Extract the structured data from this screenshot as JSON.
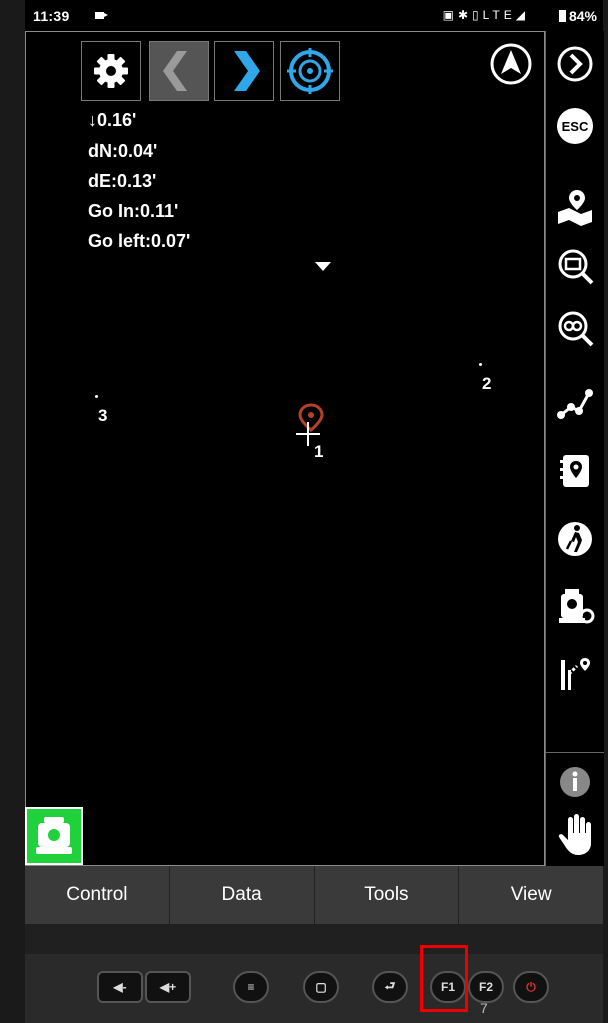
{
  "status_bar": {
    "time": "11:39",
    "network": "LTE",
    "battery": "84%"
  },
  "toolbar": {
    "settings_icon": "gear-icon",
    "back_icon": "chevron-left-icon",
    "forward_icon": "chevron-right-icon",
    "target_icon": "crosshair-target-icon"
  },
  "readouts": {
    "vertical": "↓0.16'",
    "dn": "dN:0.04'",
    "de": "dE:0.13'",
    "go_in": "Go In:0.11'",
    "go_left": "Go left:0.07'"
  },
  "points": [
    {
      "label": "1"
    },
    {
      "label": "2"
    },
    {
      "label": "3"
    }
  ],
  "sidebar": {
    "items": [
      {
        "icon": "chevron-right-circle-icon"
      },
      {
        "icon": "esc-icon",
        "label": "ESC"
      },
      {
        "icon": "map-pin-layers-icon"
      },
      {
        "icon": "zoom-extents-icon"
      },
      {
        "icon": "zoom-infinity-icon"
      },
      {
        "icon": "polyline-icon"
      },
      {
        "icon": "point-book-icon"
      },
      {
        "icon": "walking-person-icon"
      },
      {
        "icon": "total-station-icon"
      },
      {
        "icon": "stakeout-icon"
      },
      {
        "icon": "info-icon"
      },
      {
        "icon": "hand-pan-icon"
      }
    ]
  },
  "tabs": [
    {
      "label": "Control"
    },
    {
      "label": "Data"
    },
    {
      "label": "Tools"
    },
    {
      "label": "View"
    }
  ],
  "hardware_keys": {
    "f1": "F1",
    "f2": "F2",
    "below_label": "7"
  },
  "colors": {
    "accent_blue": "#2fa7e8",
    "instrument_green": "#1fd13a",
    "point_marker": "#b8402a",
    "highlight_red": "#e00000"
  }
}
